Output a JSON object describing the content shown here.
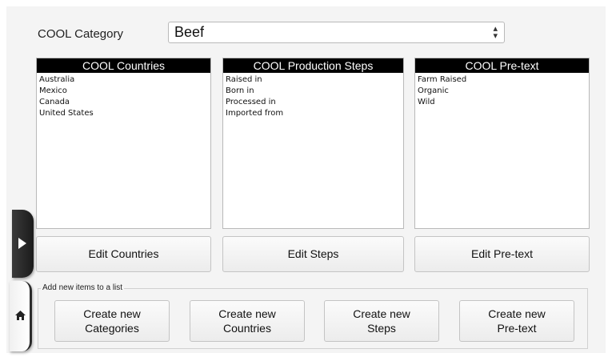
{
  "category": {
    "label": "COOL Category",
    "selected": "Beef"
  },
  "lists": [
    {
      "header": "COOL Countries",
      "items": [
        "Australia",
        "Mexico",
        "Canada",
        "United States"
      ],
      "edit_label": "Edit Countries"
    },
    {
      "header": "COOL Production Steps",
      "items": [
        "Raised in",
        "Born in",
        "Processed in",
        "Imported from"
      ],
      "edit_label": "Edit Steps"
    },
    {
      "header": "COOL Pre-text",
      "items": [
        "Farm Raised",
        "Organic",
        "Wild"
      ],
      "edit_label": "Edit Pre-text"
    }
  ],
  "add_group": {
    "legend": "Add new items to a list",
    "buttons": [
      "Create new\nCategories",
      "Create new\nCountries",
      "Create new\nSteps",
      "Create new\nPre-text"
    ]
  },
  "side_tabs": {
    "expand_icon": "play-arrow-icon",
    "home_icon": "home-icon"
  }
}
